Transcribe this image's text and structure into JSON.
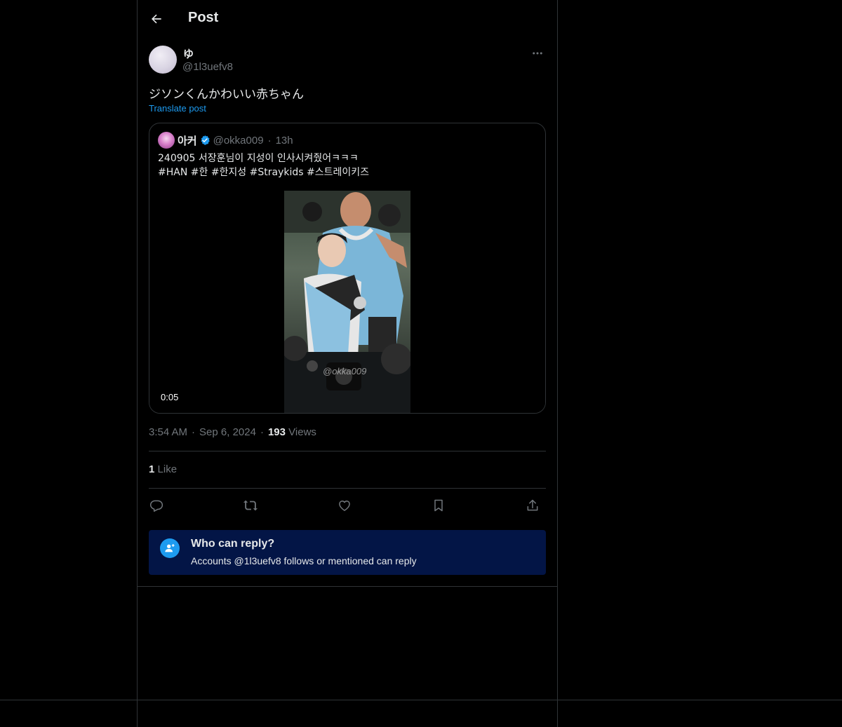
{
  "header": {
    "title": "Post",
    "back_icon": "arrow-left-icon"
  },
  "post": {
    "author": {
      "name": "ゆ",
      "handle": "@1l3uefv8"
    },
    "more_icon": "more-horizontal-icon",
    "text": "ジソンくんかわいい赤ちゃん",
    "translate_label": "Translate post",
    "quote": {
      "name": "아커",
      "verified": true,
      "handle": "@okka009",
      "dot": "·",
      "time": "13h",
      "line1": "240905 서장훈님이 지성이 인사시켜줬어ㅋㅋㅋ",
      "line2": "#HAN #한 #한지성 #Straykids #스트레이키즈",
      "video": {
        "duration": "0:05",
        "watermark": "@okka009"
      }
    },
    "meta": {
      "time": "3:54 AM",
      "dot": "·",
      "date": "Sep 6, 2024",
      "views_count": "193",
      "views_label": "Views"
    },
    "likes": {
      "count": "1",
      "label": "Like"
    },
    "actions": {
      "reply_icon": "reply-icon",
      "repost_icon": "repost-icon",
      "like_icon": "heart-icon",
      "bookmark_icon": "bookmark-icon",
      "share_icon": "share-icon"
    }
  },
  "reply_restriction": {
    "title": "Who can reply?",
    "subtitle": "Accounts @1l3uefv8 follows or mentioned can reply"
  },
  "colors": {
    "background": "#000000",
    "border": "#2f3336",
    "text_primary": "#e7e9ea",
    "text_secondary": "#71767b",
    "accent": "#1d9bf0",
    "reply_box": "#031546"
  }
}
